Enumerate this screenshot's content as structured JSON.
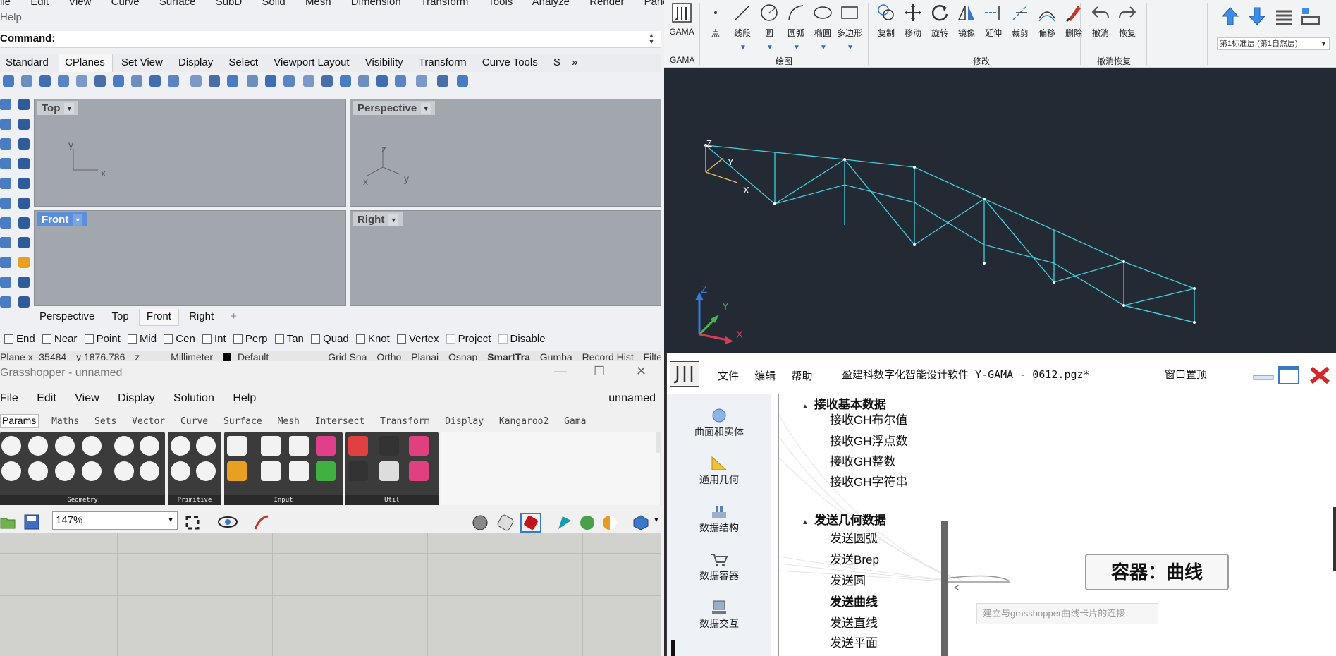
{
  "rhino": {
    "menu": [
      "ile",
      "Edit",
      "View",
      "Curve",
      "Surface",
      "SubD",
      "Solid",
      "Mesh",
      "Dimension",
      "Transform",
      "Tools",
      "Analyze",
      "Render",
      "Panels"
    ],
    "help": "Help",
    "command_label": "Command:",
    "toolbar_tabs": [
      "Standard",
      "CPlanes",
      "Set View",
      "Display",
      "Select",
      "Viewport Layout",
      "Visibility",
      "Transform",
      "Curve Tools",
      "S"
    ],
    "active_tab": "CPlanes",
    "tabs_more": "»",
    "viewports": {
      "top": {
        "title": "Top",
        "axes": [
          "y",
          "x"
        ]
      },
      "perspective": {
        "title": "Perspective",
        "axes": [
          "z",
          "x",
          "y"
        ]
      },
      "front": {
        "title": "Front"
      },
      "right": {
        "title": "Right"
      }
    },
    "view_tabs": [
      "Perspective",
      "Top",
      "Front",
      "Right",
      "+"
    ],
    "active_view_tab": "Front",
    "osnaps": [
      "End",
      "Near",
      "Point",
      "Mid",
      "Cen",
      "Int",
      "Perp",
      "Tan",
      "Quad",
      "Knot",
      "Vertex",
      "Project",
      "Disable"
    ],
    "status": {
      "cplane": "Plane x -35484",
      "y": "y 1876.786",
      "z": "z",
      "units": "Millimeter",
      "layer": "Default",
      "items": [
        "Grid Sna",
        "Ortho",
        "Planai",
        "Osnap",
        "SmartTra",
        "Gumba",
        "Record Hist",
        "Filte"
      ]
    }
  },
  "gama": {
    "logo_label": "GAMA",
    "buttons": [
      {
        "label": "点",
        "icon": "point-icon"
      },
      {
        "label": "线段",
        "icon": "line-icon"
      },
      {
        "label": "圆",
        "icon": "circle-icon"
      },
      {
        "label": "圆弧",
        "icon": "arc-icon"
      },
      {
        "label": "椭圆",
        "icon": "ellipse-icon"
      },
      {
        "label": "多边形",
        "icon": "polygon-icon"
      },
      {
        "label": "复制",
        "icon": "copy-icon"
      },
      {
        "label": "移动",
        "icon": "move-icon"
      },
      {
        "label": "旋转",
        "icon": "rotate-icon"
      },
      {
        "label": "镜像",
        "icon": "mirror-icon"
      },
      {
        "label": "延伸",
        "icon": "extend-icon"
      },
      {
        "label": "裁剪",
        "icon": "trim-icon"
      },
      {
        "label": "偏移",
        "icon": "offset-icon"
      },
      {
        "label": "删除",
        "icon": "delete-icon"
      },
      {
        "label": "撤消",
        "icon": "undo-icon"
      },
      {
        "label": "恢复",
        "icon": "redo-icon"
      }
    ],
    "sections": [
      "GAMA",
      "绘图",
      "修改",
      "撤消恢复"
    ],
    "layer_select": "第1标准层 (第1自然层)",
    "view_axes": [
      "Z",
      "Y",
      "X"
    ],
    "colors": {
      "truss": "#3fd0e0",
      "bg": "#232a33"
    }
  },
  "grasshopper": {
    "title": "Grasshopper - unnamed",
    "menu": [
      "File",
      "Edit",
      "View",
      "Display",
      "Solution",
      "Help"
    ],
    "doc_name": "unnamed",
    "tabs": [
      "Params",
      "Maths",
      "Sets",
      "Vector",
      "Curve",
      "Surface",
      "Mesh",
      "Intersect",
      "Transform",
      "Display",
      "Kangaroo2",
      "Gama"
    ],
    "active_tab": "Params",
    "panels": [
      "Geometry",
      "Primitive",
      "Input",
      "Util"
    ],
    "zoom": "147%"
  },
  "ygama": {
    "menu": [
      "文件",
      "编辑",
      "帮助"
    ],
    "title": "盈建科数字化智能设计软件 Y-GAMA - 0612.pgz*",
    "pin_label": "窗口置顶",
    "sidebar": [
      "曲面和实体",
      "通用几何",
      "数据结构",
      "数据容器",
      "数据交互"
    ],
    "tree": {
      "group1_title": "接收基本数据",
      "group1_items": [
        "接收GH布尔值",
        "接收GH浮点数",
        "接收GH整数",
        "接收GH字符串"
      ],
      "group2_title": "发送几何数据",
      "group2_items": [
        "发送圆弧",
        "发送Brep",
        "发送圆",
        "发送曲线",
        "发送直线",
        "发送平面"
      ]
    },
    "node_label": "容器：曲线",
    "tooltip": "建立与grasshopper曲线卡片的连接."
  }
}
